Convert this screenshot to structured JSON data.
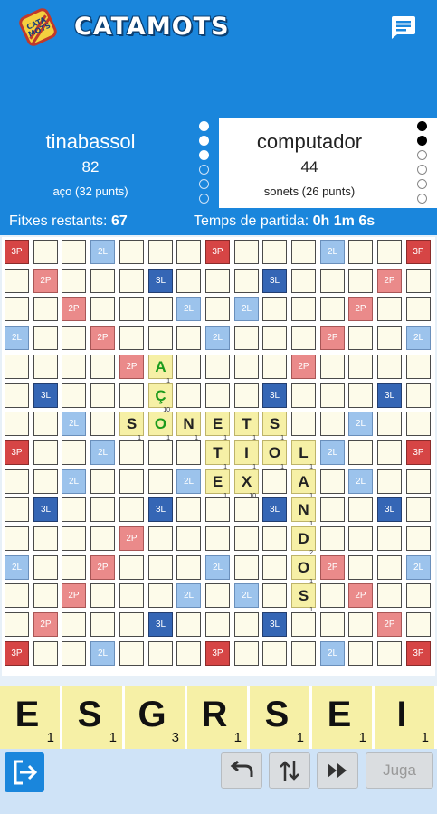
{
  "header": {
    "title": "CATAMOTS",
    "logo_text": "CATA MOTS",
    "chat_icon": "chat-icon",
    "color": "#1a86dc"
  },
  "players": [
    {
      "name": "tinabassol",
      "score": "82",
      "last_play": "aço (32 punts)",
      "dots": [
        true,
        true,
        true,
        false,
        false,
        false
      ]
    },
    {
      "name": "computador",
      "score": "44",
      "last_play": "sonets (26 punts)",
      "dots": [
        true,
        true,
        false,
        false,
        false,
        false
      ]
    }
  ],
  "info": {
    "tiles_label": "Fitxes restants:",
    "tiles_value": "67",
    "time_label": "Temps de partida:",
    "time_value": "0h 1m 6s"
  },
  "board": {
    "premium_labels": {
      "tp": "3P",
      "dp": "2P",
      "tl": "3L",
      "dl": "2L"
    },
    "premium_cells": [
      [
        0,
        0,
        "tp"
      ],
      [
        0,
        3,
        "dl"
      ],
      [
        0,
        7,
        "tp"
      ],
      [
        0,
        11,
        "dl"
      ],
      [
        0,
        14,
        "tp"
      ],
      [
        1,
        1,
        "dp"
      ],
      [
        1,
        5,
        "tl"
      ],
      [
        1,
        9,
        "tl"
      ],
      [
        1,
        13,
        "dp"
      ],
      [
        2,
        2,
        "dp"
      ],
      [
        2,
        6,
        "dl"
      ],
      [
        2,
        8,
        "dl"
      ],
      [
        2,
        12,
        "dp"
      ],
      [
        3,
        0,
        "dl"
      ],
      [
        3,
        3,
        "dp"
      ],
      [
        3,
        7,
        "dl"
      ],
      [
        3,
        11,
        "dp"
      ],
      [
        3,
        14,
        "dl"
      ],
      [
        4,
        4,
        "dp"
      ],
      [
        4,
        10,
        "dp"
      ],
      [
        5,
        1,
        "tl"
      ],
      [
        5,
        9,
        "tl"
      ],
      [
        5,
        13,
        "tl"
      ],
      [
        6,
        2,
        "dl"
      ],
      [
        6,
        12,
        "dl"
      ],
      [
        7,
        0,
        "tp"
      ],
      [
        7,
        3,
        "dl"
      ],
      [
        7,
        11,
        "dl"
      ],
      [
        7,
        14,
        "tp"
      ],
      [
        8,
        2,
        "dl"
      ],
      [
        8,
        6,
        "dl"
      ],
      [
        8,
        12,
        "dl"
      ],
      [
        9,
        1,
        "tl"
      ],
      [
        9,
        5,
        "tl"
      ],
      [
        9,
        9,
        "tl"
      ],
      [
        9,
        13,
        "tl"
      ],
      [
        10,
        4,
        "dp"
      ],
      [
        10,
        10,
        "dp"
      ],
      [
        11,
        0,
        "dl"
      ],
      [
        11,
        3,
        "dp"
      ],
      [
        11,
        7,
        "dl"
      ],
      [
        11,
        11,
        "dp"
      ],
      [
        11,
        14,
        "dl"
      ],
      [
        12,
        2,
        "dp"
      ],
      [
        12,
        6,
        "dl"
      ],
      [
        12,
        8,
        "dl"
      ],
      [
        12,
        12,
        "dp"
      ],
      [
        13,
        1,
        "dp"
      ],
      [
        13,
        5,
        "tl"
      ],
      [
        13,
        9,
        "tl"
      ],
      [
        13,
        13,
        "dp"
      ],
      [
        14,
        0,
        "tp"
      ],
      [
        14,
        3,
        "dl"
      ],
      [
        14,
        7,
        "tp"
      ],
      [
        14,
        11,
        "dl"
      ],
      [
        14,
        14,
        "tp"
      ]
    ],
    "tiles": [
      {
        "r": 4,
        "c": 5,
        "letter": "A",
        "points": "1",
        "new": true
      },
      {
        "r": 5,
        "c": 5,
        "letter": "Ç",
        "points": "10",
        "new": true
      },
      {
        "r": 6,
        "c": 4,
        "letter": "S",
        "points": "1",
        "new": false
      },
      {
        "r": 6,
        "c": 5,
        "letter": "O",
        "points": "1",
        "new": true
      },
      {
        "r": 6,
        "c": 6,
        "letter": "N",
        "points": "1",
        "new": false
      },
      {
        "r": 6,
        "c": 7,
        "letter": "E",
        "points": "1",
        "new": false
      },
      {
        "r": 6,
        "c": 8,
        "letter": "T",
        "points": "1",
        "new": false
      },
      {
        "r": 6,
        "c": 9,
        "letter": "S",
        "points": "1",
        "new": false
      },
      {
        "r": 7,
        "c": 7,
        "letter": "T",
        "points": "1",
        "new": false
      },
      {
        "r": 7,
        "c": 8,
        "letter": "I",
        "points": "1",
        "new": false
      },
      {
        "r": 7,
        "c": 9,
        "letter": "O",
        "points": "1",
        "new": false
      },
      {
        "r": 7,
        "c": 10,
        "letter": "L",
        "points": "1",
        "new": false
      },
      {
        "r": 8,
        "c": 7,
        "letter": "E",
        "points": "1",
        "new": false
      },
      {
        "r": 8,
        "c": 8,
        "letter": "X",
        "points": "10",
        "new": false
      },
      {
        "r": 8,
        "c": 10,
        "letter": "A",
        "points": "1",
        "new": false
      },
      {
        "r": 9,
        "c": 10,
        "letter": "N",
        "points": "1",
        "new": false
      },
      {
        "r": 10,
        "c": 10,
        "letter": "D",
        "points": "2",
        "new": false
      },
      {
        "r": 11,
        "c": 10,
        "letter": "O",
        "points": "1",
        "new": false
      },
      {
        "r": 12,
        "c": 10,
        "letter": "S",
        "points": "1",
        "new": false
      }
    ]
  },
  "rack": [
    {
      "letter": "E",
      "points": "1"
    },
    {
      "letter": "S",
      "points": "1"
    },
    {
      "letter": "G",
      "points": "3"
    },
    {
      "letter": "R",
      "points": "1"
    },
    {
      "letter": "S",
      "points": "1"
    },
    {
      "letter": "E",
      "points": "1"
    },
    {
      "letter": "I",
      "points": "1"
    }
  ],
  "controls": {
    "exit_icon": "exit-icon",
    "undo_icon": "undo-icon",
    "swap_icon": "swap-icon",
    "pass_icon": "fast-forward-icon",
    "play_label": "Juga"
  }
}
